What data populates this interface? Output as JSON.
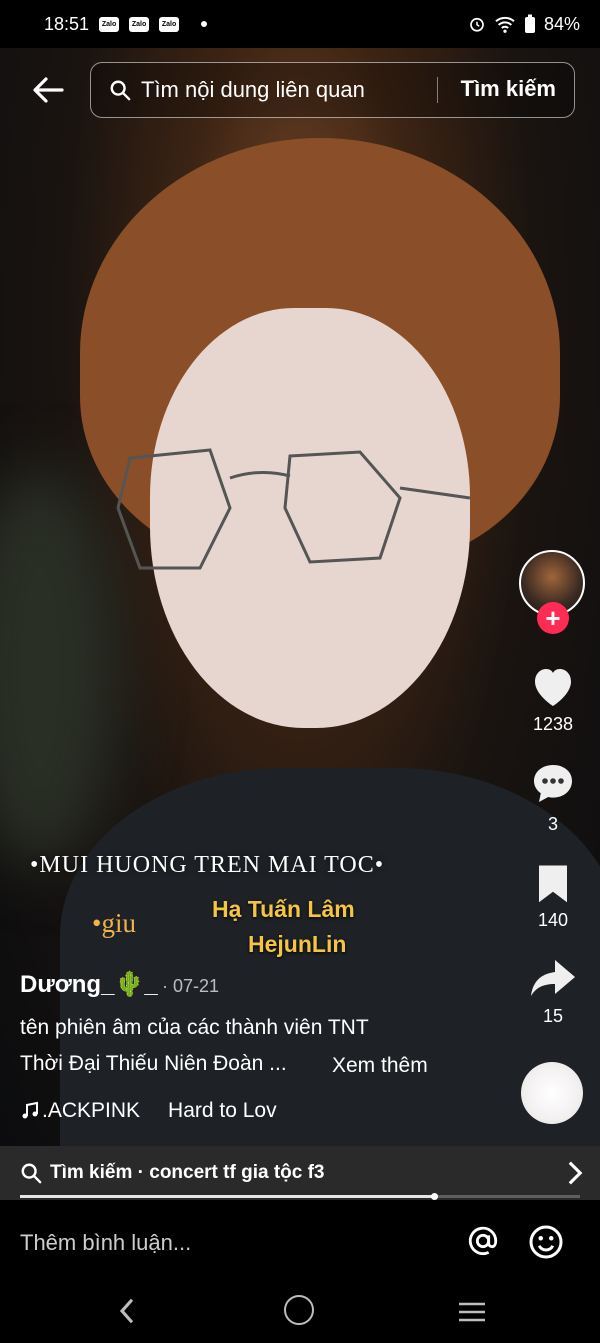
{
  "status_bar": {
    "time": "18:51",
    "notification_icons": [
      "Zalo",
      "Zalo",
      "Zalo"
    ],
    "battery": "84%"
  },
  "search": {
    "query": "Tìm nội dung liên quan",
    "button_label": "Tìm kiếm"
  },
  "overlay": {
    "title": "•MUI HUONG TREN MAI TOC•",
    "tag": "•giu",
    "name_line1": "Hạ Tuấn Lâm",
    "name_line2": "HejunLin"
  },
  "actions": {
    "likes": "1238",
    "comments": "3",
    "saves": "140",
    "shares": "15"
  },
  "post": {
    "author": "Dương_🌵_",
    "date": "· 07-21",
    "caption_line1": "tên phiên âm của các thành viên TNT",
    "caption_line2": "Thời Đại Thiếu Niên Đoàn ...",
    "see_more": "Xem thêm",
    "music_artist": ".ACKPINK",
    "music_title": "Hard to Lov"
  },
  "related_search": {
    "label": "Tìm kiếm · concert tf gia tộc f3"
  },
  "progress": {
    "played_fraction": 0.74
  },
  "comment": {
    "placeholder": "Thêm bình luận..."
  },
  "colors": {
    "accent": "#fe2c55",
    "overlay_gold": "#f5c542"
  }
}
